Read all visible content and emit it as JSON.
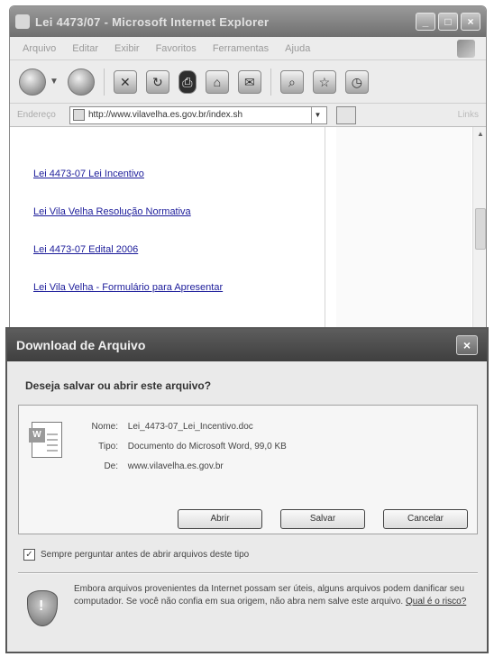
{
  "browser": {
    "title": "Lei 4473/07 - Microsoft Internet Explorer",
    "menu": [
      "Arquivo",
      "Editar",
      "Exibir",
      "Favoritos",
      "Ferramentas",
      "Ajuda"
    ],
    "address_label": "Endereço",
    "url": "http://www.vilavelha.es.gov.br/index.sh",
    "links_label": "Links"
  },
  "page": {
    "links": [
      "Lei 4473-07 Lei Incentivo",
      "Lei Vila Velha Resolução Normativa",
      "Lei 4473-07 Edital 2006",
      "Lei Vila Velha - Formulário para Apresentar"
    ]
  },
  "dialog": {
    "title": "Download de Arquivo",
    "question": "Deseja salvar ou abrir este arquivo?",
    "name_label": "Nome:",
    "name_value": "Lei_4473-07_Lei_Incentivo.doc",
    "type_label": "Tipo:",
    "type_value": "Documento do Microsoft Word, 99,0 KB",
    "from_label": "De:",
    "from_value": "www.vilavelha.es.gov.br",
    "open_label": "Abrir",
    "save_label": "Salvar",
    "cancel_label": "Cancelar",
    "checkbox_label": "Sempre perguntar antes de abrir arquivos deste tipo",
    "warning_text": "Embora arquivos provenientes da Internet possam ser úteis, alguns arquivos podem danificar seu computador. Se você não confia em sua origem, não abra nem salve este arquivo.",
    "warning_link": "Qual é o risco?"
  }
}
